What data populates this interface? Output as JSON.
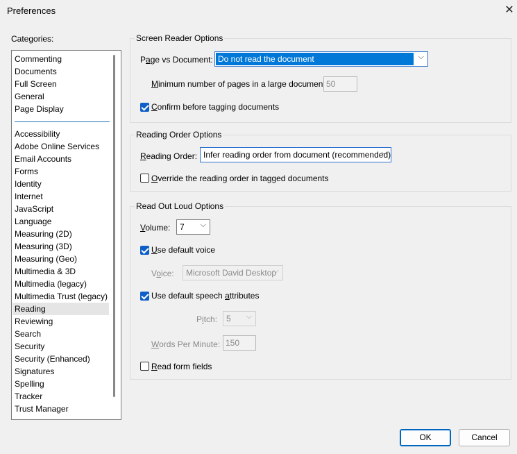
{
  "window": {
    "title": "Preferences"
  },
  "categories": {
    "label": "Categories:",
    "top_items": [
      "Commenting",
      "Documents",
      "Full Screen",
      "General",
      "Page Display"
    ],
    "items": [
      "Accessibility",
      "Adobe Online Services",
      "Email Accounts",
      "Forms",
      "Identity",
      "Internet",
      "JavaScript",
      "Language",
      "Measuring (2D)",
      "Measuring (3D)",
      "Measuring (Geo)",
      "Multimedia & 3D",
      "Multimedia (legacy)",
      "Multimedia Trust (legacy)",
      "Reading",
      "Reviewing",
      "Search",
      "Security",
      "Security (Enhanced)",
      "Signatures",
      "Spelling",
      "Tracker",
      "Trust Manager"
    ],
    "selected": "Reading"
  },
  "screen_reader": {
    "legend": "Screen Reader Options",
    "page_vs_doc_label_pre": "P",
    "page_vs_doc_label_ul": "a",
    "page_vs_doc_label_post": "ge vs Document:",
    "page_vs_doc_value": "Do not read the document",
    "min_pages_label_ul": "M",
    "min_pages_label_post": "inimum number of pages in a large document:",
    "min_pages_value": "50",
    "confirm_ul": "C",
    "confirm_post": "onfirm before tagging documents",
    "confirm_checked": true
  },
  "reading_order": {
    "legend": "Reading Order Options",
    "label_ul": "R",
    "label_post": "eading Order:",
    "value": "Infer reading order from document (recommended)",
    "override_ul": "O",
    "override_post": "verride the reading order in tagged documents",
    "override_checked": false
  },
  "read_out_loud": {
    "legend": "Read Out Loud Options",
    "volume_ul": "V",
    "volume_post": "olume:",
    "volume_value": "7",
    "use_default_voice_ul": "U",
    "use_default_voice_post": "se default voice",
    "use_default_voice_checked": true,
    "voice_label_pre": "V",
    "voice_label_ul": "o",
    "voice_label_post": "ice:",
    "voice_value": "Microsoft David Desktop",
    "use_default_speech_pre": "Use default speech ",
    "use_default_speech_ul": "a",
    "use_default_speech_post": "ttributes",
    "use_default_speech_checked": true,
    "pitch_label_pre": "P",
    "pitch_label_ul": "i",
    "pitch_label_post": "tch:",
    "pitch_value": "5",
    "wpm_label_ul": "W",
    "wpm_label_post": "ords Per Minute:",
    "wpm_value": "150",
    "read_form_ul": "R",
    "read_form_post": "ead form fields",
    "read_form_checked": false
  },
  "buttons": {
    "ok": "OK",
    "cancel": "Cancel"
  }
}
